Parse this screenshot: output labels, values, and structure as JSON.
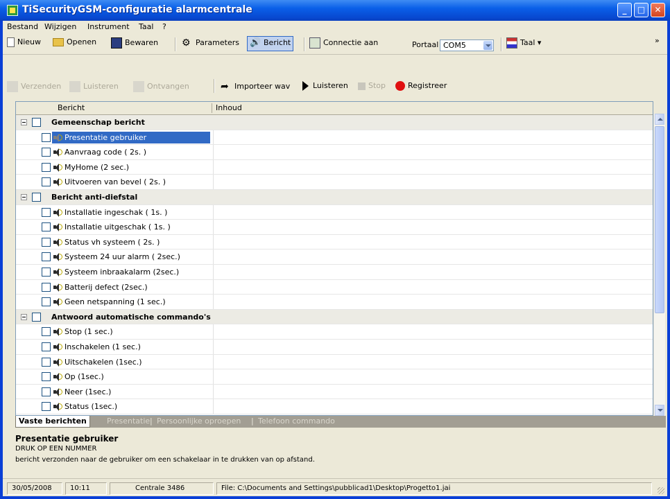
{
  "window": {
    "title": "TiSecurityGSM-configuratie  alarmcentrale"
  },
  "menu": [
    "Bestand",
    "Wijzigen",
    "Instrument",
    "Taal",
    "?"
  ],
  "toolbar1": {
    "nieuw": "Nieuw",
    "openen": "Openen",
    "bewaren": "Bewaren",
    "parameters": "Parameters",
    "bericht": "Bericht",
    "connectie": "Connectie aan",
    "poort_label": "Portaal",
    "poort_value": "COM5",
    "taal": "Taal",
    "overflow": "»"
  },
  "toolbar2": {
    "verzenden": "Verzenden",
    "luisteren_dis": "Luisteren",
    "ontvangen": "Ontvangen",
    "importeer": "Importeer wav",
    "luisteren": "Luisteren",
    "stop": "Stop",
    "registreer": "Registreer"
  },
  "grid": {
    "columns": [
      "Bericht",
      "Inhoud"
    ],
    "groups": [
      {
        "label": "Gemeenschap bericht",
        "items": [
          "Presentatie gebruiker",
          "Aanvraag code ( 2s. )",
          "MyHome (2 sec.)",
          "Uitvoeren van bevel ( 2s. )"
        ]
      },
      {
        "label": "Bericht anti-diefstal",
        "items": [
          "Installatie ingeschak ( 1s. )",
          "Installatie uitgeschak ( 1s. )",
          "Status vh systeem ( 2s. )",
          "Systeem 24 uur alarm ( 2sec.)",
          "Systeem inbraakalarm (2sec.)",
          "Batterij defect (2sec.)",
          "Geen netspanning (1 sec.)"
        ]
      },
      {
        "label": "Antwoord automatische commando's",
        "items": [
          "Stop  (1 sec.)",
          "Inschakelen (1 sec.)",
          "Uitschakelen (1sec.)",
          "Op (1sec.)",
          "Neer (1sec.)",
          "Status (1sec.)"
        ]
      }
    ]
  },
  "tabs": [
    "Vaste berichten",
    "Presentatie",
    "Persoonlijke oproepen",
    "Telefoon commando"
  ],
  "info": {
    "title": "Presentatie gebruiker",
    "line1": "DRUK OP EEN NUMMER",
    "line2": "bericht verzonden naar de gebruiker om een schakelaar in te drukken van op afstand."
  },
  "status": {
    "date": "30/05/2008",
    "time": "10:11",
    "centrale": "Centrale 3486",
    "file": "File: C:\\Documents and Settings\\pubblicad1\\Desktop\\Progetto1.jai"
  }
}
